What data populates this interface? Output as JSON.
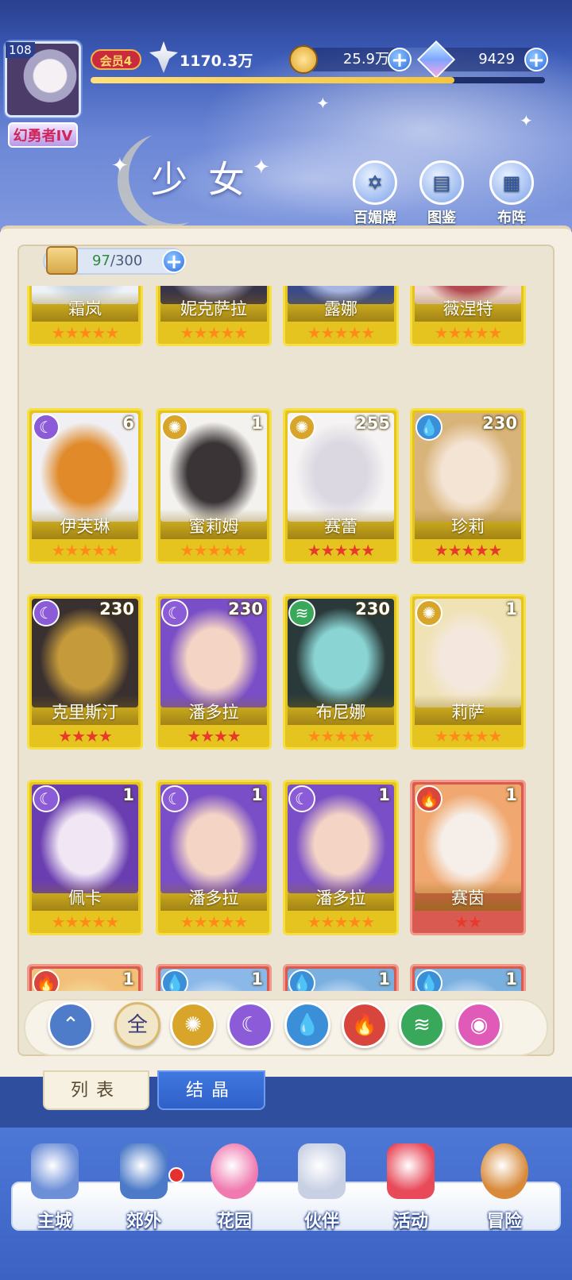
{
  "header": {
    "player_level": "108",
    "rank_title": "幻勇者IV",
    "vip": "会员4",
    "power": "1170.3万",
    "coins": "25.9万",
    "gems": "9429",
    "xp_progress": 0.8,
    "page_title": "少女",
    "buttons": [
      {
        "label": "百媚牌",
        "icon": "card-deck-icon"
      },
      {
        "label": "图鉴",
        "icon": "book-icon"
      },
      {
        "label": "布阵",
        "icon": "formation-grid-icon"
      }
    ]
  },
  "inventory": {
    "current": "97",
    "max": "/300"
  },
  "cards": [
    {
      "name": "霜岚",
      "stars": 5,
      "star_color": "orange",
      "element": "",
      "count": "",
      "frame": "gold",
      "art": [
        "#eef2f6",
        "#c9d6e4"
      ]
    },
    {
      "name": "妮克萨拉",
      "stars": 5,
      "star_color": "orange",
      "element": "",
      "count": "",
      "frame": "gold",
      "art": [
        "#3a3448",
        "#9c96a8"
      ]
    },
    {
      "name": "露娜",
      "stars": 5,
      "star_color": "orange",
      "element": "",
      "count": "",
      "frame": "gold",
      "art": [
        "#3a4a8a",
        "#a7b4e0"
      ]
    },
    {
      "name": "薇涅特",
      "stars": 5,
      "star_color": "orange",
      "element": "",
      "count": "",
      "frame": "gold",
      "art": [
        "#f1d7d4",
        "#b34a52"
      ]
    },
    {
      "name": "伊芙琳",
      "stars": 5,
      "star_color": "orange",
      "element": "moon",
      "count": "6",
      "frame": "gold",
      "art": [
        "#f0f0f4",
        "#e08a2a"
      ]
    },
    {
      "name": "蜜莉姆",
      "stars": 5,
      "star_color": "orange",
      "element": "sun",
      "count": "1",
      "frame": "gold",
      "art": [
        "#f4f2ee",
        "#3a3436"
      ]
    },
    {
      "name": "赛蕾",
      "stars": 5,
      "star_color": "red",
      "element": "sun",
      "count": "255",
      "frame": "gold",
      "art": [
        "#f5f3f3",
        "#dcd8e2"
      ]
    },
    {
      "name": "珍莉",
      "stars": 5,
      "star_color": "red",
      "element": "water",
      "count": "230",
      "frame": "gold",
      "art": [
        "#d9b47a",
        "#f4e4d4"
      ]
    },
    {
      "name": "克里斯汀",
      "stars": 4,
      "star_color": "red",
      "element": "moon",
      "count": "230",
      "frame": "gold",
      "art": [
        "#3a3030",
        "#c59a3a"
      ]
    },
    {
      "name": "潘多拉",
      "stars": 4,
      "star_color": "red",
      "element": "moon",
      "count": "230",
      "frame": "gold",
      "art": [
        "#7a4ec6",
        "#f4d4c4"
      ]
    },
    {
      "name": "布尼娜",
      "stars": 5,
      "star_color": "orange",
      "element": "wind",
      "count": "230",
      "frame": "gold",
      "art": [
        "#2a3a3a",
        "#8ad4d4"
      ]
    },
    {
      "name": "莉萨",
      "stars": 5,
      "star_color": "orange",
      "element": "sun",
      "count": "1",
      "frame": "gold",
      "art": [
        "#efe2b4",
        "#f4e8de"
      ]
    },
    {
      "name": "佩卡",
      "stars": 5,
      "star_color": "orange",
      "element": "moon",
      "count": "1",
      "frame": "gold",
      "art": [
        "#6a3eb0",
        "#f0e6f4"
      ]
    },
    {
      "name": "潘多拉",
      "stars": 5,
      "star_color": "orange",
      "element": "moon",
      "count": "1",
      "frame": "gold",
      "art": [
        "#7a4ec6",
        "#f4d4c4"
      ]
    },
    {
      "name": "潘多拉",
      "stars": 5,
      "star_color": "orange",
      "element": "moon",
      "count": "1",
      "frame": "gold",
      "art": [
        "#7a4ec6",
        "#f4d4c4"
      ]
    },
    {
      "name": "赛茵",
      "stars": 2,
      "star_color": "red",
      "element": "fire",
      "count": "1",
      "frame": "red",
      "art": [
        "#f0a870",
        "#f6efe9"
      ]
    },
    {
      "name": "",
      "stars": 0,
      "star_color": "orange",
      "element": "fire",
      "count": "1",
      "frame": "red",
      "art": [
        "#f3c07a",
        "#f0e0a0"
      ]
    },
    {
      "name": "",
      "stars": 0,
      "star_color": "orange",
      "element": "water",
      "count": "1",
      "frame": "red",
      "art": [
        "#8ab8e8",
        "#d6e6f8"
      ]
    },
    {
      "name": "",
      "stars": 0,
      "star_color": "orange",
      "element": "water",
      "count": "1",
      "frame": "red",
      "art": [
        "#7ab0e0",
        "#d6e6f8"
      ]
    },
    {
      "name": "",
      "stars": 0,
      "star_color": "orange",
      "element": "water",
      "count": "1",
      "frame": "red",
      "art": [
        "#7ab0e0",
        "#d6e6f8"
      ]
    }
  ],
  "element_colors": {
    "moon": "#8c5bd8",
    "sun": "#d8a52a",
    "water": "#3b8fd8",
    "fire": "#d8453c",
    "wind": "#3aa85a"
  },
  "filters": [
    {
      "key": "light",
      "label": "",
      "icon": "light-arrow-icon",
      "color": "#4e7cc8"
    },
    {
      "key": "all",
      "label": "全",
      "icon": "all-icon",
      "color": "#f1e6c8"
    },
    {
      "key": "sun",
      "label": "",
      "icon": "sun-icon",
      "color": "#d8a52a"
    },
    {
      "key": "moon",
      "label": "",
      "icon": "moon-icon",
      "color": "#8c5bd8"
    },
    {
      "key": "water",
      "label": "",
      "icon": "water-drop-icon",
      "color": "#3b8fd8"
    },
    {
      "key": "fire",
      "label": "",
      "icon": "fire-icon",
      "color": "#d8453c"
    },
    {
      "key": "wind",
      "label": "",
      "icon": "wind-icon",
      "color": "#3aa85a"
    },
    {
      "key": "spirit",
      "label": "",
      "icon": "spirit-icon",
      "color": "#e05ab8"
    }
  ],
  "tabs": [
    {
      "label": "列表",
      "active": true
    },
    {
      "label": "结晶",
      "active": false
    }
  ],
  "nav": [
    {
      "label": "主城",
      "icon": "castle-icon",
      "color": "#6d8fd8"
    },
    {
      "label": "郊外",
      "icon": "star-gate-icon",
      "color": "#4c7ac8",
      "badge": true
    },
    {
      "label": "花园",
      "icon": "heart-icon",
      "color": "#f07ab0"
    },
    {
      "label": "伙伴",
      "icon": "companion-avatar-icon",
      "color": "#c8d0e4",
      "active": true
    },
    {
      "label": "活动",
      "icon": "gift-icon",
      "color": "#e84a5a"
    },
    {
      "label": "冒险",
      "icon": "compass-icon",
      "color": "#d88a3a"
    }
  ]
}
